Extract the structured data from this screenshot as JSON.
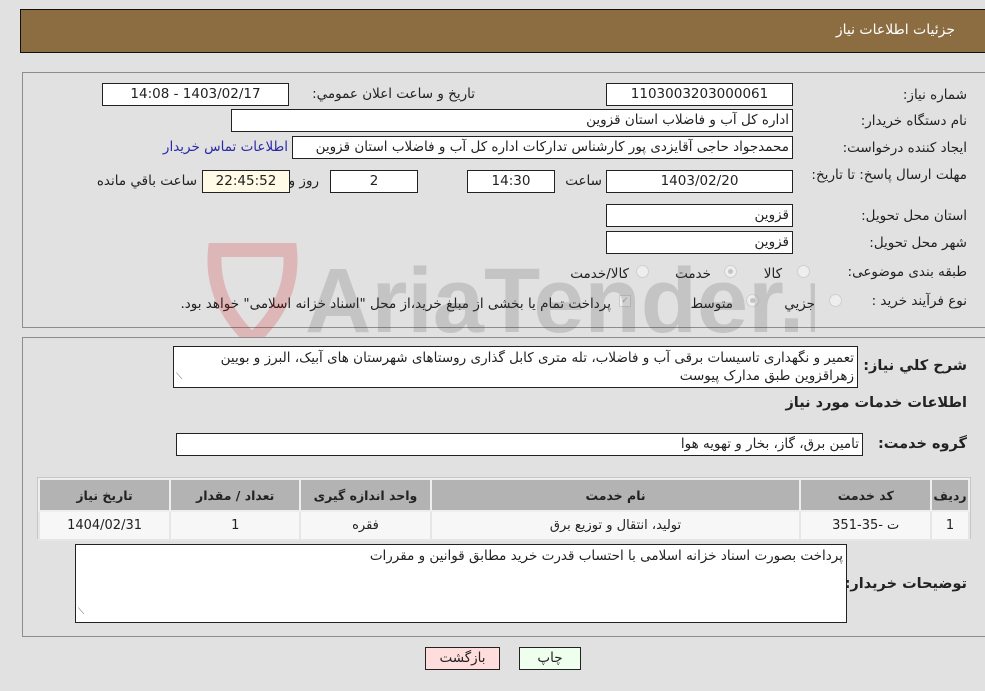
{
  "header": {
    "title": "جزئیات اطلاعات نیاز"
  },
  "form": {
    "need_number_label": "شماره نیاز:",
    "need_number": "1103003203000061",
    "announce_label": "تاريخ و ساعت اعلان عمومي:",
    "announce_value": "1403/02/17 - 14:08",
    "buyer_org_label": "نام دستگاه خريدار:",
    "buyer_org": "اداره کل آب و فاضلاب استان قزوین",
    "creator_label": "ايجاد کننده درخواست:",
    "creator": "محمدجواد حاجی آقایزدی پور کارشناس تدارکات اداره کل آب و فاضلاب استان قزوین",
    "contact_link": "اطلاعات تماس خریدار",
    "deadline_label": "مهلت ارسال پاسخ: تا تاریخ:",
    "deadline_date": "1403/02/20",
    "time_label": "ساعت",
    "deadline_time": "14:30",
    "days_value": "2",
    "days_label": "روز و",
    "remaining_time": "22:45:52",
    "remaining_label": "ساعت باقي مانده",
    "province_label": "استان محل تحویل:",
    "province": "قزوین",
    "city_label": "شهر محل تحویل:",
    "city": "قزوین",
    "category_label": "طبقه بندی موضوعی:",
    "category_options": [
      "کالا",
      "خدمت",
      "کالا/خدمت"
    ],
    "category_selected": "خدمت",
    "process_label": "نوع فرآيند خريد :",
    "process_options": [
      "جزيي",
      "متوسط"
    ],
    "process_selected": "متوسط",
    "treasury_note": "پرداخت تمام یا بخشی از مبلغ خرید،از محل \"اسناد خزانه اسلامی\" خواهد بود."
  },
  "description": {
    "label": "شرح کلي نياز:",
    "text": "تعمیر و نگهداری تاسیسات برقی آب و فاضلاب، تله متری کابل گذاری روستاهای شهرستان های آبیک، البرز و بویین زهراقزوین طبق مدارک پیوست"
  },
  "services": {
    "section_title": "اطلاعات خدمات مورد نياز",
    "group_label": "گروه خدمت:",
    "group_value": "تامین برق، گاز، بخار و تهویه هوا",
    "columns": [
      "رديف",
      "کد خدمت",
      "نام خدمت",
      "واحد اندازه گيری",
      "تعداد / مقدار",
      "تاريخ نياز"
    ],
    "rows": [
      [
        "1",
        "ت -35-351",
        "تولید، انتقال و توزیع برق",
        "فقره",
        "1",
        "1404/02/31"
      ]
    ]
  },
  "buyer_notes": {
    "label": "توضيحات خريدار:",
    "text": "پرداخت بصورت اسناد خزانه اسلامی با احتساب قدرت خرید مطابق قوانین و مقررات"
  },
  "buttons": {
    "print": "چاپ",
    "back": "بازگشت"
  },
  "watermark": {
    "text": "AriaTender.neT"
  },
  "colors": {
    "header": "#8c6d42",
    "print_bg": "#eeffee",
    "back_bg": "#ffdddd",
    "link": "#2a2aa8"
  }
}
